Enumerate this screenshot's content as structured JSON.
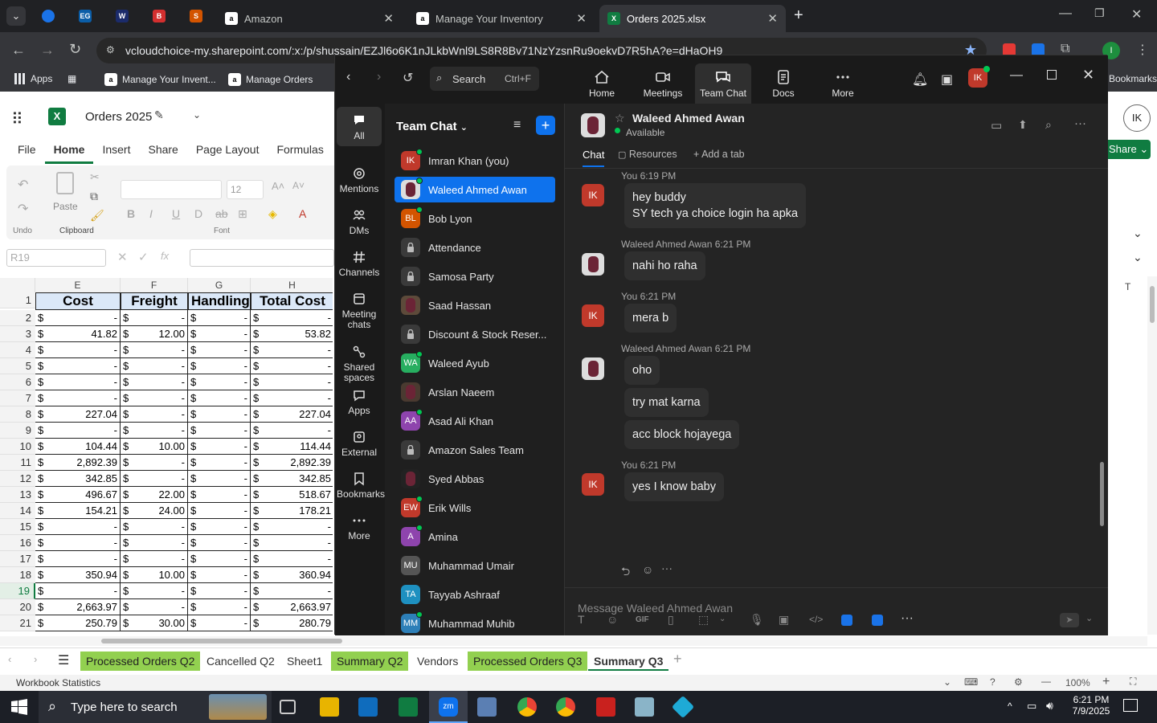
{
  "browser": {
    "tabs": [
      {
        "label": "Amazon",
        "favicon": "amazon-a"
      },
      {
        "label": "Manage Your Inventory",
        "favicon": "amazon-a"
      },
      {
        "label": "Orders 2025.xlsx",
        "favicon": "excel"
      }
    ],
    "url": "vcloudchoice-my.sharepoint.com/:x:/p/shussain/EZJl6o6K1nJLkbWnl9LS8R8Bv71NzYzsnRu9oekvD7R5hA?e=dHaOH9",
    "bookmarks": [
      "Apps",
      "Manage Your Invent...",
      "Manage Orders",
      "Bookmarks"
    ]
  },
  "excel": {
    "title": "Orders 2025",
    "ribbon_tabs": [
      "File",
      "Home",
      "Insert",
      "Share",
      "Page Layout",
      "Formulas"
    ],
    "ribbon_groups": [
      "Undo",
      "Clipboard",
      "Font"
    ],
    "paste_label": "Paste",
    "font_size": "12",
    "name_box": "R19",
    "share_label": "Share",
    "user_initials": "IK",
    "columns": [
      "E",
      "F",
      "G",
      "H"
    ],
    "extra_column": "T",
    "headers": [
      "Cost",
      "Freight",
      "Handling",
      "Total Cost"
    ],
    "rows": [
      {
        "n": "2",
        "cells": [
          "-",
          "-",
          "-",
          "-"
        ]
      },
      {
        "n": "3",
        "cells": [
          "41.82",
          "12.00",
          "-",
          "53.82"
        ]
      },
      {
        "n": "4",
        "cells": [
          "-",
          "-",
          "-",
          "-"
        ]
      },
      {
        "n": "5",
        "cells": [
          "-",
          "-",
          "-",
          "-"
        ]
      },
      {
        "n": "6",
        "cells": [
          "-",
          "-",
          "-",
          "-"
        ]
      },
      {
        "n": "7",
        "cells": [
          "-",
          "-",
          "-",
          "-"
        ]
      },
      {
        "n": "8",
        "cells": [
          "227.04",
          "-",
          "-",
          "227.04"
        ]
      },
      {
        "n": "9",
        "cells": [
          "-",
          "-",
          "-",
          "-"
        ]
      },
      {
        "n": "10",
        "cells": [
          "104.44",
          "10.00",
          "-",
          "114.44"
        ]
      },
      {
        "n": "11",
        "cells": [
          "2,892.39",
          "-",
          "-",
          "2,892.39"
        ]
      },
      {
        "n": "12",
        "cells": [
          "342.85",
          "-",
          "-",
          "342.85"
        ]
      },
      {
        "n": "13",
        "cells": [
          "496.67",
          "22.00",
          "-",
          "518.67"
        ]
      },
      {
        "n": "14",
        "cells": [
          "154.21",
          "24.00",
          "-",
          "178.21"
        ]
      },
      {
        "n": "15",
        "cells": [
          "-",
          "-",
          "-",
          "-"
        ]
      },
      {
        "n": "16",
        "cells": [
          "-",
          "-",
          "-",
          "-"
        ]
      },
      {
        "n": "17",
        "cells": [
          "-",
          "-",
          "-",
          "-"
        ]
      },
      {
        "n": "18",
        "cells": [
          "350.94",
          "10.00",
          "-",
          "360.94"
        ]
      },
      {
        "n": "19",
        "cells": [
          "-",
          "-",
          "-",
          "-"
        ]
      },
      {
        "n": "20",
        "cells": [
          "2,663.97",
          "-",
          "-",
          "2,663.97"
        ]
      },
      {
        "n": "21",
        "cells": [
          "250.79",
          "30.00",
          "-",
          "280.79"
        ]
      }
    ],
    "currency": "$",
    "sheet_tabs": [
      {
        "label": "Processed Orders Q2",
        "style": "green"
      },
      {
        "label": "Cancelled Q2",
        "style": "plain"
      },
      {
        "label": "Sheet1",
        "style": "plain"
      },
      {
        "label": "Summary Q2",
        "style": "green"
      },
      {
        "label": "Vendors",
        "style": "plain"
      },
      {
        "label": "Processed Orders Q3",
        "style": "green"
      },
      {
        "label": "Summary Q3",
        "style": "active"
      }
    ],
    "status_left": "Workbook Statistics",
    "zoom": "100%"
  },
  "zoom": {
    "search_label": "Search",
    "search_shortcut": "Ctrl+F",
    "nav": [
      "Home",
      "Meetings",
      "Team Chat",
      "Docs",
      "More"
    ],
    "user_initials": "IK",
    "sidebar": [
      "All",
      "Mentions",
      "DMs",
      "Channels",
      "Meeting chats",
      "Shared spaces",
      "Apps",
      "External",
      "Bookmarks",
      "More"
    ],
    "list_title": "Team Chat",
    "contacts": [
      {
        "name": "Imran Khan (you)",
        "ini": "IK",
        "color": "#c0392b",
        "status": "online"
      },
      {
        "name": "Waleed Ahmed Awan",
        "ini": "",
        "color": "#ddd",
        "status": "online",
        "selected": true
      },
      {
        "name": "Bob Lyon",
        "ini": "BL",
        "color": "#d35400",
        "status": "online"
      },
      {
        "name": "Attendance",
        "ini": "",
        "color": "#3a3a3a",
        "status": "lock"
      },
      {
        "name": "Samosa Party",
        "ini": "",
        "color": "#3a3a3a",
        "status": "lock"
      },
      {
        "name": "Saad Hassan",
        "ini": "",
        "color": "#5d4a3a",
        "status": ""
      },
      {
        "name": "Discount & Stock Reser...",
        "ini": "",
        "color": "#3a3a3a",
        "status": "lock"
      },
      {
        "name": "Waleed Ayub",
        "ini": "WA",
        "color": "#27ae60",
        "status": "online"
      },
      {
        "name": "Arslan Naeem",
        "ini": "",
        "color": "#4a3a30",
        "status": ""
      },
      {
        "name": "Asad Ali Khan",
        "ini": "AA",
        "color": "#8e44ad",
        "status": "online"
      },
      {
        "name": "Amazon Sales Team",
        "ini": "",
        "color": "#3a3a3a",
        "status": "lock"
      },
      {
        "name": "Syed Abbas",
        "ini": "",
        "color": "#222",
        "status": ""
      },
      {
        "name": "Erik Wills",
        "ini": "EW",
        "color": "#c0392b",
        "status": "online"
      },
      {
        "name": "Amina",
        "ini": "A",
        "color": "#8e44ad",
        "status": "online"
      },
      {
        "name": "Muhammad Umair",
        "ini": "MU",
        "color": "#555",
        "status": ""
      },
      {
        "name": "Tayyab Ashraaf",
        "ini": "TA",
        "color": "#1e90c0",
        "status": ""
      },
      {
        "name": "Muhammad Muhib",
        "ini": "MM",
        "color": "#2d7fb8",
        "status": "online"
      }
    ],
    "chat": {
      "name": "Waleed Ahmed Awan",
      "status": "Available",
      "tabs": [
        "Chat",
        "Resources",
        "Add a tab"
      ],
      "messages": [
        {
          "meta": "You 6:19 PM",
          "who": "me",
          "lines": [
            "hey buddy",
            "SY tech ya choice login ha apka"
          ]
        },
        {
          "meta": "Waleed Ahmed Awan 6:21 PM",
          "who": "them",
          "lines": [
            "nahi ho raha"
          ]
        },
        {
          "meta": "You 6:21 PM",
          "who": "me",
          "lines": [
            "mera b"
          ]
        },
        {
          "meta": "Waleed Ahmed Awan 6:21 PM",
          "who": "them",
          "lines": [
            "oho"
          ]
        },
        {
          "meta": "",
          "who": "them",
          "lines": [
            "try mat karna"
          ]
        },
        {
          "meta": "",
          "who": "them",
          "lines": [
            "acc block hojayega"
          ]
        },
        {
          "meta": "You 6:21 PM",
          "who": "me",
          "lines": [
            "yes I know baby"
          ]
        }
      ],
      "composer_placeholder": "Message Waleed Ahmed Awan"
    }
  },
  "taskbar": {
    "search_placeholder": "Type here to search",
    "time": "6:21 PM",
    "date": "7/9/2025"
  }
}
